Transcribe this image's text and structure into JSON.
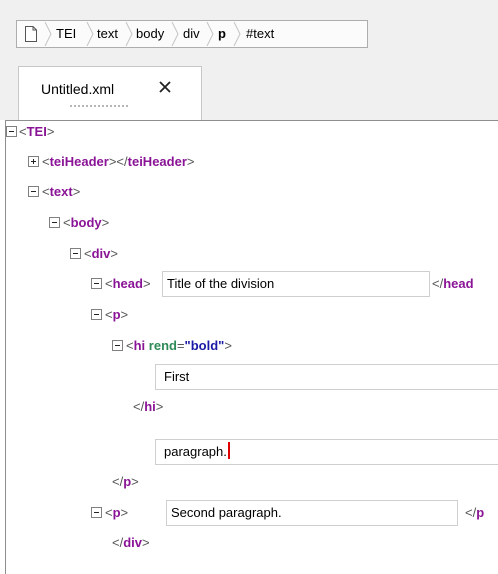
{
  "breadcrumb": {
    "items": [
      "TEI",
      "text",
      "body",
      "div",
      "p",
      "#text"
    ]
  },
  "tab": {
    "label": "Untitled.xml"
  },
  "icons": {
    "document": "document-icon",
    "close": "close-x-icon",
    "expanded": "minus-box-icon",
    "collapsed": "plus-box-icon"
  },
  "colors": {
    "element": "#8a1496",
    "attribute": "#2e8b57",
    "value": "#1a1aa6",
    "caret": "#e00000"
  },
  "tree": {
    "tei_tag": "TEI",
    "teiheader_tag": "teiHeader",
    "text_tag": "text",
    "body_tag": "body",
    "div_tag": "div",
    "head_tag": "head",
    "head_text": "Title of the division",
    "head_close": "</head",
    "p_tag": "p",
    "hi_tag": "hi",
    "hi_attr_name": "rend",
    "hi_attr_value": "bold",
    "hi_text": "First",
    "p_text": "paragraph.",
    "p2_text": "Second paragraph.",
    "p2_close": "</p"
  }
}
